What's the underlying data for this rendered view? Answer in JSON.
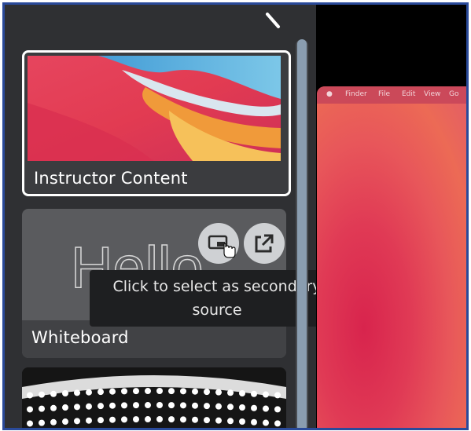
{
  "cards": [
    {
      "label": "Instructor Content",
      "selected": true
    },
    {
      "label": "Whiteboard",
      "selected": false,
      "whiteboard_text": "Hello"
    },
    {
      "label": "",
      "selected": false
    }
  ],
  "tooltip": {
    "line1": "Click to select as secondary",
    "line2": "source"
  },
  "buttons": {
    "secondary_icon": "secondary-source-icon",
    "popout_icon": "external-link-icon"
  },
  "preview": {
    "menu": [
      "",
      "Finder",
      "File",
      "Edit",
      "View",
      "Go"
    ]
  },
  "colors": {
    "frame_border": "#2a4a9a",
    "panel": "#2f3033",
    "selected_border": "#ffffff",
    "tooltip_bg": "#1e1f21"
  }
}
